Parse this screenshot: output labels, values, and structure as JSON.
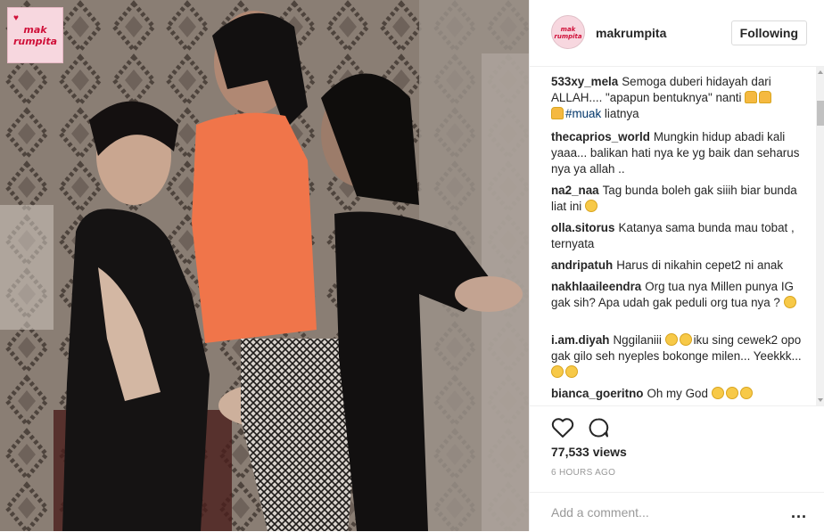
{
  "media": {
    "watermark_line1": "mak",
    "watermark_line2": "rumpita"
  },
  "header": {
    "avatar_line1": "mak",
    "avatar_line2": "rumpita",
    "username": "makrumpita",
    "follow_label": "Following"
  },
  "comments": [
    {
      "user": "533xy_mela",
      "text_parts": [
        "Semoga duberi hidayah dari ALLAH.... \"apapun bentuknya\" nanti ",
        " ",
        " ",
        "#muak",
        " liatnya"
      ]
    },
    {
      "user": "thecaprios_world",
      "text": "Mungkin hidup abadi kali yaaa... balikan hati nya ke yg baik dan seharus nya ya allah .."
    },
    {
      "user": "na2_naa",
      "text": "Tag bunda boleh gak siiih biar bunda liat ini"
    },
    {
      "user": "olla.sitorus",
      "text": "Katanya sama bunda mau tobat , ternyata"
    },
    {
      "user": "andripatuh",
      "text": "Harus di nikahin cepet2 ni anak"
    },
    {
      "user": "nakhlaaileendra",
      "text": "Org tua nya Millen punya IG gak sih? Apa udah gak peduli org tua nya ?"
    },
    {
      "user": "i.am.diyah",
      "text_a": "Nggilaniii",
      "text_b": "iku sing cewek2 opo gak gilo seh nyeples bokonge milen... Yeekkk..."
    },
    {
      "user": "bianca_goeritno",
      "text": "Oh my God"
    }
  ],
  "stats": {
    "views": "77,533 views",
    "time": "6 HOURS AGO"
  },
  "composer": {
    "placeholder": "Add a comment...",
    "more_label": "..."
  },
  "icons": {
    "like": "heart-icon",
    "comment": "comment-bubble-icon",
    "more": "more-options-icon"
  },
  "colors": {
    "text": "#262626",
    "muted": "#999999",
    "hashtag": "#003569",
    "border": "#efefef",
    "watermark": "#d0113a"
  }
}
